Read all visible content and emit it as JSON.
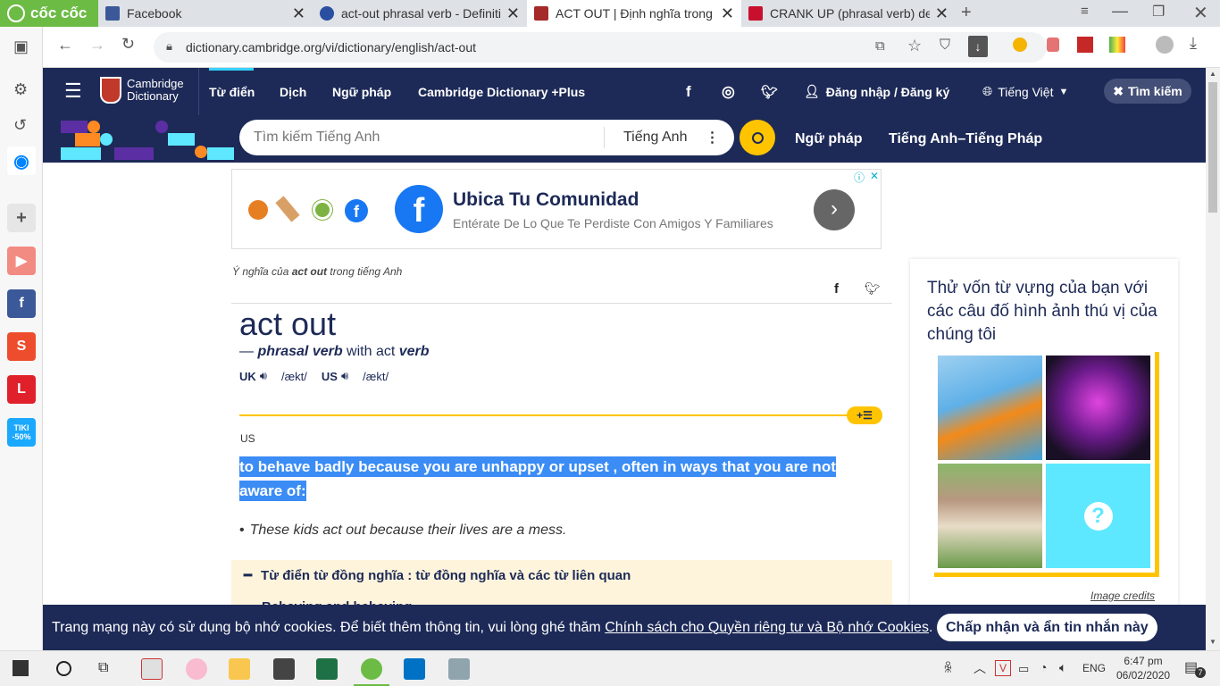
{
  "browser": {
    "logo": "cốc cốc",
    "tabs": [
      {
        "title": "Facebook"
      },
      {
        "title": "act-out phrasal verb - Definitio"
      },
      {
        "title": "ACT OUT | Định nghĩa trong T"
      },
      {
        "title": "CRANK UP (phrasal verb) defi"
      }
    ],
    "url": "dictionary.cambridge.org/vi/dictionary/english/act-out"
  },
  "header": {
    "logo_line1": "Cambridge",
    "logo_line2": "Dictionary",
    "nav": [
      "Từ điển",
      "Dịch",
      "Ngữ pháp",
      "Cambridge Dictionary +Plus"
    ],
    "login": "Đăng nhập / Đăng ký",
    "language": "Tiếng Việt",
    "search_button": "Tìm kiếm"
  },
  "subheader": {
    "search_placeholder": "Tìm kiếm Tiếng Anh",
    "dictionary_select": "Tiếng Anh",
    "links": [
      "Ngữ pháp",
      "Tiếng Anh–Tiếng Pháp"
    ]
  },
  "ad": {
    "title": "Ubica Tu Comunidad",
    "subtitle": "Entérate De Lo Que Te Perdiste Con Amigos Y Familiares"
  },
  "entry": {
    "breadcrumb_pre": "Ý nghĩa của ",
    "breadcrumb_word": "act out",
    "breadcrumb_post": " trong tiếng Anh",
    "headword": "act out",
    "pos_dash": "— ",
    "pos": "phrasal verb",
    "pos_with": " with act ",
    "pos_verb": "verb",
    "uk_label": "UK",
    "uk_pron": "/ækt/",
    "us_label": "US",
    "us_pron": "/ækt/",
    "region": "US",
    "definition": "to behave badly because you are unhappy or upset , often in ways that you are not aware of:",
    "example": "These kids act out because their lives are a mess.",
    "thesaurus": "Từ điển từ đồng nghĩa : từ đồng nghĩa và các từ liên quan",
    "more": "Behaving and behaving"
  },
  "quiz": {
    "title": "Thử vốn từ vựng của bạn với các câu đố hình ảnh thú vị của chúng tôi",
    "credits": "Image credits"
  },
  "cookie": {
    "text": "Trang mạng này có sử dụng bộ nhớ cookies. Để biết thêm thông tin, vui lòng ghé thăm ",
    "link": "Chính sách cho Quyền riêng tư và Bộ nhớ Cookies",
    "period": ".",
    "button": "Chấp nhận và ẩn tin nhắn này"
  },
  "taskbar": {
    "time": "6:47 pm",
    "date": "06/02/2020",
    "lang": "ENG",
    "notif": "7"
  },
  "colors": {
    "navy": "#1d2a57",
    "yellow": "#fec400",
    "highlight": "#3b8cf5"
  }
}
